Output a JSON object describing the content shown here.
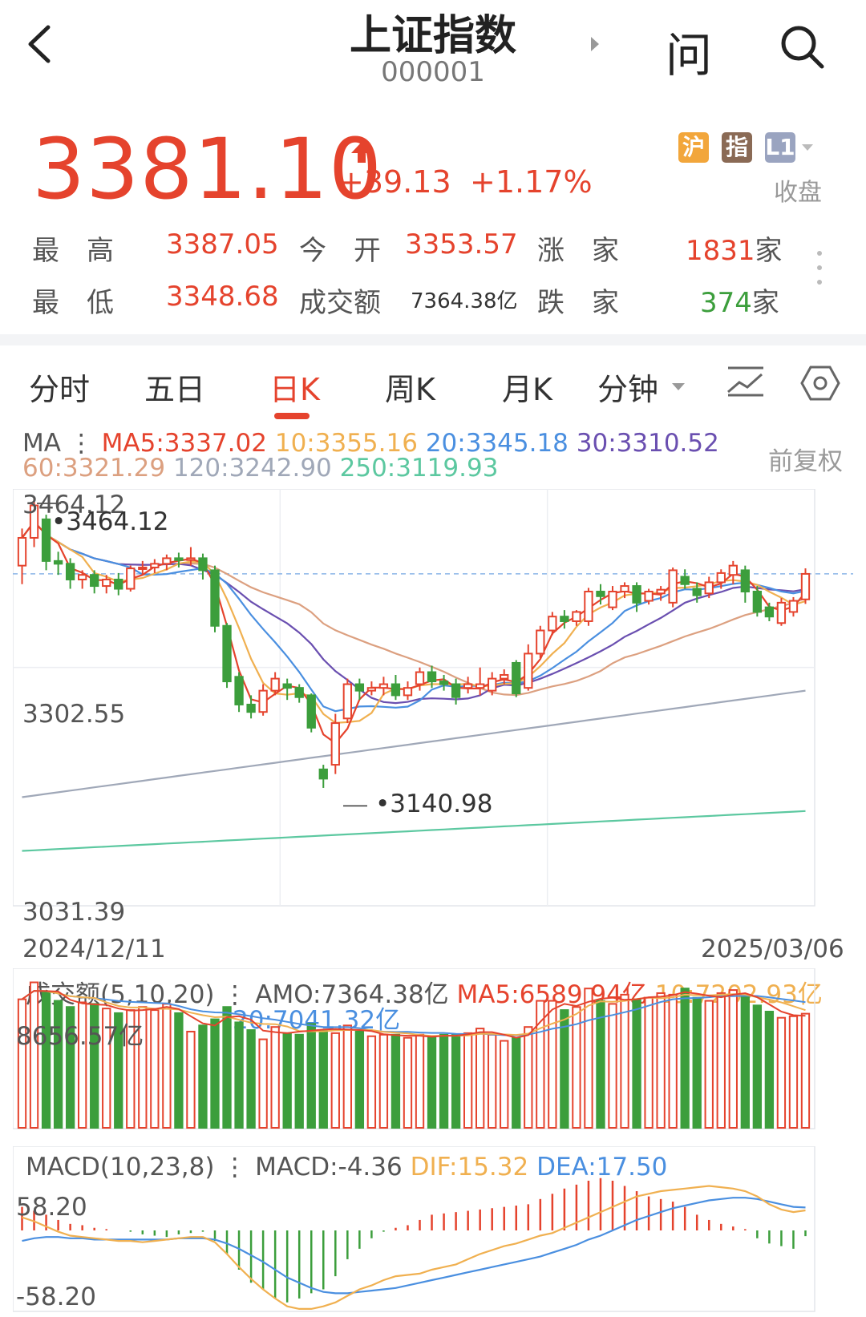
{
  "header": {
    "title": "上证指数",
    "code": "000001",
    "ask_label": "问"
  },
  "quote": {
    "price": "3381.10",
    "change": "+39.13",
    "change_pct": "+1.17%",
    "status": "收盘",
    "badges": [
      {
        "label": "沪",
        "color": "#f2a63b"
      },
      {
        "label": "指",
        "color": "#8a6a55"
      },
      {
        "label": "L1",
        "color": "#9aa4c0"
      }
    ],
    "stats": [
      {
        "label": "最　高",
        "value": "3387.05"
      },
      {
        "label": "今　开",
        "value": "3353.57"
      },
      {
        "label": "涨　家",
        "value": "1831",
        "suffix": "家"
      },
      {
        "label": "最　低",
        "value": "3348.68"
      },
      {
        "label": "成交额",
        "value": "7364.38亿"
      },
      {
        "label": "跌　家",
        "value": "374",
        "suffix": "家"
      }
    ]
  },
  "tabs": [
    "分时",
    "五日",
    "日K",
    "周K",
    "月K",
    "分钟"
  ],
  "active_tab": "日K",
  "ma_legend": {
    "prefix": "MA",
    "right_label": "前复权",
    "items": [
      {
        "text": "MA5:3337.02",
        "color": "#e5432d"
      },
      {
        "text": "10:3355.16",
        "color": "#f0b050"
      },
      {
        "text": "20:3345.18",
        "color": "#4a8fe0"
      },
      {
        "text": "30:3310.52",
        "color": "#6a4fb0"
      },
      {
        "text": "60:3321.29",
        "color": "#dca080"
      },
      {
        "text": "120:3242.90",
        "color": "#a0a8b8"
      },
      {
        "text": "250:3119.93",
        "color": "#5cc8a0"
      }
    ]
  },
  "chart_data": [
    {
      "type": "candlestick",
      "title": "",
      "y_axis_labels": [
        "3464.12",
        "3302.55",
        "3031.39"
      ],
      "annotations": {
        "high": "3464.12",
        "low": "3140.98"
      },
      "x_axis_labels": [
        "2024/12/11",
        "2025/03/06"
      ],
      "ylim": [
        3031.39,
        3464.12
      ],
      "reference_line": 3381.1,
      "candles": [
        [
          3390,
          3420,
          3370,
          3430
        ],
        [
          3420,
          3455,
          3410,
          3464.12
        ],
        [
          3440,
          3395,
          3385,
          3445
        ],
        [
          3395,
          3392,
          3380,
          3405
        ],
        [
          3392,
          3375,
          3365,
          3398
        ],
        [
          3375,
          3380,
          3365,
          3385
        ],
        [
          3380,
          3368,
          3360,
          3385
        ],
        [
          3368,
          3375,
          3360,
          3380
        ],
        [
          3375,
          3365,
          3358,
          3382
        ],
        [
          3365,
          3387,
          3362,
          3390
        ],
        [
          3387,
          3388,
          3380,
          3395
        ],
        [
          3388,
          3392,
          3382,
          3397
        ],
        [
          3392,
          3398,
          3385,
          3402
        ],
        [
          3398,
          3396,
          3388,
          3404
        ],
        [
          3396,
          3398,
          3390,
          3410
        ],
        [
          3398,
          3385,
          3375,
          3403
        ],
        [
          3385,
          3325,
          3318,
          3390
        ],
        [
          3325,
          3265,
          3258,
          3328
        ],
        [
          3270,
          3240,
          3232,
          3275
        ],
        [
          3240,
          3232,
          3225,
          3250
        ],
        [
          3232,
          3255,
          3228,
          3262
        ],
        [
          3255,
          3268,
          3250,
          3275
        ],
        [
          3262,
          3258,
          3245,
          3268
        ],
        [
          3258,
          3248,
          3242,
          3262
        ],
        [
          3250,
          3215,
          3210,
          3252
        ],
        [
          3170,
          3160,
          3150,
          3175
        ],
        [
          3175,
          3220,
          3165,
          3230
        ],
        [
          3225,
          3262,
          3220,
          3268
        ],
        [
          3262,
          3255,
          3245,
          3268
        ],
        [
          3255,
          3258,
          3250,
          3265
        ],
        [
          3258,
          3262,
          3250,
          3270
        ],
        [
          3262,
          3250,
          3245,
          3272
        ],
        [
          3250,
          3258,
          3245,
          3265
        ],
        [
          3262,
          3275,
          3255,
          3280
        ],
        [
          3275,
          3265,
          3258,
          3282
        ],
        [
          3265,
          3262,
          3255,
          3272
        ],
        [
          3262,
          3248,
          3240,
          3268
        ],
        [
          3258,
          3262,
          3252,
          3270
        ],
        [
          3258,
          3262,
          3250,
          3280
        ],
        [
          3255,
          3268,
          3250,
          3275
        ],
        [
          3268,
          3272,
          3262,
          3278
        ],
        [
          3285,
          3252,
          3248,
          3288
        ],
        [
          3258,
          3295,
          3255,
          3305
        ],
        [
          3295,
          3320,
          3290,
          3325
        ],
        [
          3320,
          3335,
          3315,
          3340
        ],
        [
          3335,
          3330,
          3322,
          3342
        ],
        [
          3330,
          3340,
          3325,
          3342
        ],
        [
          3330,
          3362,
          3325,
          3366
        ],
        [
          3362,
          3357,
          3348,
          3370
        ],
        [
          3345,
          3362,
          3342,
          3368
        ],
        [
          3362,
          3368,
          3355,
          3372
        ],
        [
          3368,
          3350,
          3340,
          3372
        ],
        [
          3352,
          3362,
          3348,
          3365
        ],
        [
          3360,
          3364,
          3352,
          3368
        ],
        [
          3350,
          3385,
          3345,
          3388
        ],
        [
          3378,
          3370,
          3365,
          3386
        ],
        [
          3365,
          3358,
          3350,
          3372
        ],
        [
          3360,
          3372,
          3355,
          3378
        ],
        [
          3372,
          3382,
          3365,
          3386
        ],
        [
          3380,
          3390,
          3370,
          3395
        ],
        [
          3385,
          3362,
          3350,
          3390
        ],
        [
          3362,
          3340,
          3335,
          3368
        ],
        [
          3345,
          3335,
          3330,
          3350
        ],
        [
          3328,
          3350,
          3325,
          3355
        ],
        [
          3340,
          3352,
          3335,
          3356
        ],
        [
          3353.57,
          3381.1,
          3348.68,
          3387.05
        ]
      ]
    },
    {
      "type": "bar",
      "title": "成交额(5,10,20)",
      "header": [
        "成交额(5,10,20)",
        "AMO:7364.38亿",
        "MA5:6589.94亿",
        "10:7202.93亿",
        "20:7041.32亿"
      ],
      "y_axis_labels": [
        "8656.57亿"
      ],
      "ylim": [
        0,
        10000
      ],
      "values": [
        8300,
        9400,
        8800,
        8200,
        7800,
        8100,
        8000,
        7700,
        7400,
        7600,
        7800,
        7600,
        8000,
        7400,
        6200,
        6600,
        7000,
        7800,
        6800,
        6300,
        5700,
        6500,
        6100,
        6000,
        6700,
        6300,
        6100,
        6600,
        6200,
        5900,
        6000,
        6000,
        5800,
        6000,
        5800,
        6000,
        6000,
        6100,
        6400,
        6000,
        5600,
        5800,
        6500,
        8200,
        8200,
        7600,
        7800,
        9000,
        8200,
        8000,
        8600,
        8300,
        8400,
        8700,
        8600,
        9000,
        8400,
        8200,
        8700,
        8900,
        8500,
        7900,
        7500,
        7100,
        7200,
        7364.38
      ]
    },
    {
      "type": "macd",
      "title": "MACD(10,23,8)",
      "header": [
        "MACD(10,23,8)",
        "MACD:-4.36",
        "DIF:15.32",
        "DEA:17.50"
      ],
      "y_axis_labels": [
        "58.20",
        "-58.20"
      ],
      "ylim": [
        -58.2,
        58.2
      ],
      "histogram": [
        18,
        15,
        12,
        8,
        5,
        4,
        2,
        1,
        0,
        -1,
        -3,
        -4,
        -5,
        -3,
        -2,
        -1,
        -8,
        -18,
        -30,
        -40,
        -45,
        -52,
        -55,
        -52,
        -48,
        -45,
        -35,
        -22,
        -14,
        -6,
        -1,
        2,
        4,
        8,
        12,
        13,
        14,
        15,
        16,
        17,
        18,
        19,
        20,
        24,
        28,
        32,
        35,
        38,
        40,
        38,
        34,
        30,
        26,
        24,
        22,
        18,
        12,
        8,
        5,
        3,
        1,
        -6,
        -10,
        -12,
        -14,
        -4.36
      ],
      "dif": [
        10,
        7,
        3,
        -1,
        -4,
        -5,
        -6,
        -7,
        -8,
        -8,
        -9,
        -8,
        -7,
        -6,
        -5,
        -5,
        -9,
        -18,
        -28,
        -37,
        -45,
        -52,
        -58,
        -60,
        -60,
        -58,
        -55,
        -50,
        -45,
        -42,
        -38,
        -35,
        -34,
        -33,
        -30,
        -28,
        -26,
        -22,
        -18,
        -15,
        -12,
        -10,
        -7,
        -4,
        -2,
        2,
        6,
        10,
        14,
        18,
        22,
        26,
        28,
        30,
        31,
        32,
        33,
        34,
        33,
        32,
        30,
        26,
        20,
        16,
        14,
        15.32
      ],
      "dea": [
        -8,
        -6,
        -5,
        -5,
        -6,
        -6,
        -7,
        -7,
        -7,
        -7,
        -7,
        -7,
        -7,
        -6,
        -6,
        -6,
        -7,
        -10,
        -14,
        -19,
        -24,
        -30,
        -36,
        -40,
        -44,
        -47,
        -48,
        -48,
        -47,
        -46,
        -45,
        -44,
        -42,
        -40,
        -38,
        -36,
        -34,
        -32,
        -30,
        -28,
        -26,
        -24,
        -22,
        -20,
        -17,
        -14,
        -11,
        -7,
        -4,
        0,
        4,
        8,
        11,
        14,
        17,
        19,
        21,
        23,
        24,
        25,
        25,
        24,
        22,
        20,
        18,
        17.5
      ]
    }
  ]
}
